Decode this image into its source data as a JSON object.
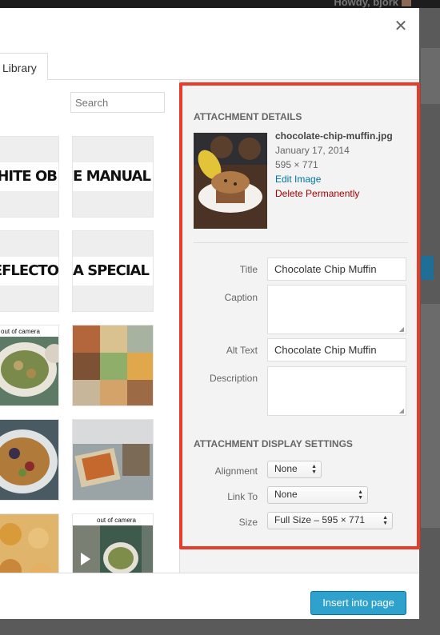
{
  "header": {
    "user_greeting": "Howdy, bjork"
  },
  "tabs": [
    {
      "label": "Library"
    }
  ],
  "search": {
    "placeholder": "Search"
  },
  "library": {
    "thumb_texts": [
      "WHITE OB",
      "E MANUAL SE",
      "REFLECTO",
      "A SPECIAL LI"
    ],
    "photo_captions": [
      "out of camera",
      "out of camera"
    ]
  },
  "details": {
    "section_title": "Attachment Details",
    "filename": "chocolate-chip-muffin.jpg",
    "date": "January 17, 2014",
    "dimensions": "595 × 771",
    "edit_link": "Edit Image",
    "delete_link": "Delete Permanently",
    "fields": {
      "title_label": "Title",
      "title_value": "Chocolate Chip Muffin",
      "caption_label": "Caption",
      "alt_label": "Alt Text",
      "alt_value": "Chocolate Chip Muffin",
      "description_label": "Description"
    }
  },
  "display_settings": {
    "section_title": "Attachment Display Settings",
    "alignment_label": "Alignment",
    "alignment_value": "None",
    "link_label": "Link To",
    "link_value": "None",
    "size_label": "Size",
    "size_value": "Full Size – 595 × 771"
  },
  "footer": {
    "insert_button": "Insert into page"
  },
  "colors": {
    "highlight": "#e73c2a",
    "primary_button": "#2ea2cc",
    "link": "#0074a2",
    "delete": "#aa0000"
  }
}
